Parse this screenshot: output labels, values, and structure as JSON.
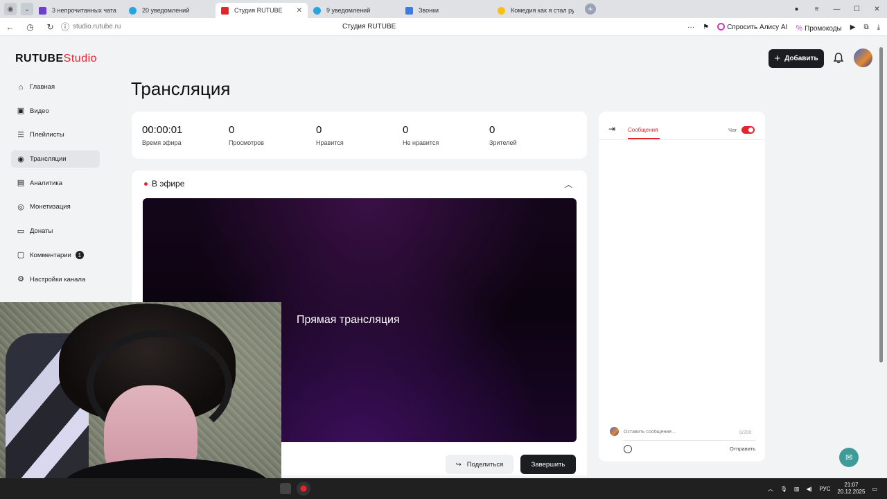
{
  "browser": {
    "tabs": [
      {
        "label": "3 непрочитанных чата",
        "color": "#6a3fd1"
      },
      {
        "label": "20 уведомлений",
        "color": "#2aa3e0"
      },
      {
        "label": "Студия RUTUBE",
        "color": "#e4262c"
      },
      {
        "label": "9 уведомлений",
        "color": "#2aa3e0"
      },
      {
        "label": "Звонки",
        "color": "#3c7be3"
      },
      {
        "label": "Комедия как я стал русс...",
        "color": "#f2c311"
      }
    ],
    "url": "studio.rutube.ru",
    "page_title": "Студия RUTUBE",
    "alice_label": "Спросить Алису AI",
    "promo_label": "Промокоды"
  },
  "header": {
    "logo_main": "RUTUBE",
    "logo_studio": "Studio",
    "add_label": "Добавить"
  },
  "sidebar": {
    "items": [
      {
        "label": "Главная",
        "icon": "home-icon"
      },
      {
        "label": "Видео",
        "icon": "video-icon"
      },
      {
        "label": "Плейлисты",
        "icon": "playlist-icon"
      },
      {
        "label": "Трансляции",
        "icon": "broadcast-icon"
      },
      {
        "label": "Аналитика",
        "icon": "analytics-icon"
      },
      {
        "label": "Монетизация",
        "icon": "monetization-icon"
      },
      {
        "label": "Донаты",
        "icon": "donate-icon"
      },
      {
        "label": "Комментарии",
        "icon": "comments-icon",
        "badge": "1"
      },
      {
        "label": "Настройки канала",
        "icon": "settings-icon"
      }
    ]
  },
  "main": {
    "title": "Трансляция",
    "stats": [
      {
        "value": "00:00:01",
        "label": "Время эфира"
      },
      {
        "value": "0",
        "label": "Просмотров"
      },
      {
        "value": "0",
        "label": "Нравится"
      },
      {
        "value": "0",
        "label": "Не нравится"
      },
      {
        "value": "0",
        "label": "Зрителей"
      }
    ],
    "live_status": "В эфире",
    "player_text": "Прямая трансляция",
    "share_label": "Поделиться",
    "end_label": "Завершить"
  },
  "chat": {
    "tab_label": "Сообщения",
    "toggle_label": "Чат",
    "input_placeholder": "Оставить сообщение...",
    "counter": "0/200",
    "send_label": "Отправить"
  },
  "taskbar": {
    "lang": "РУС",
    "time": "21:07",
    "date": "20.12.2025"
  },
  "colors": {
    "accent": "#e4262c",
    "dark": "#1c1d21"
  }
}
